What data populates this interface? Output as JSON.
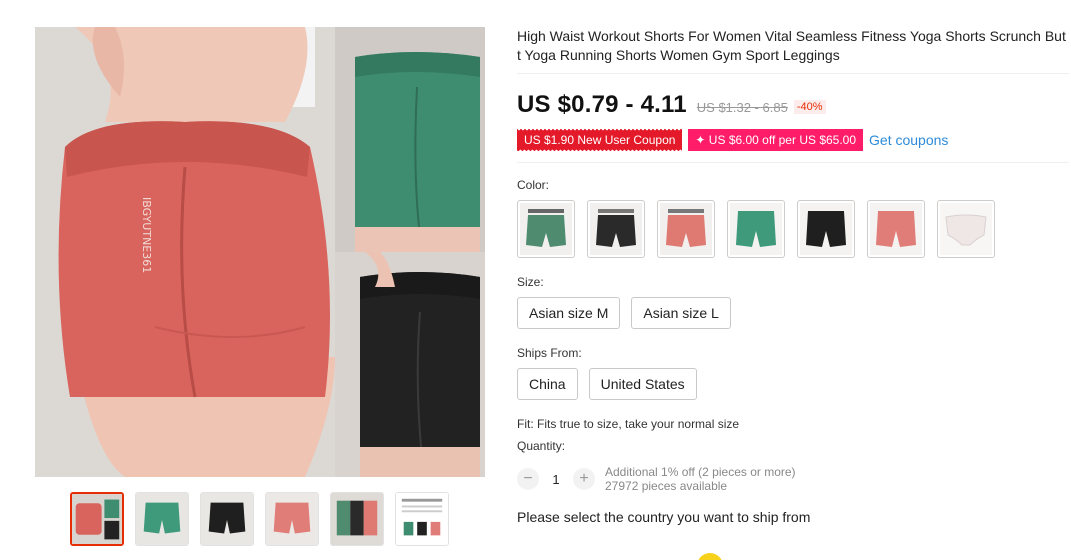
{
  "product": {
    "title": "High Waist Workout Shorts For Women Vital Seamless Fitness Yoga Shorts Scrunch Butt Yoga Running Shorts Women Gym Sport Leggings"
  },
  "price": {
    "current": "US $0.79 - 4.11",
    "original": "US $1.32 - 6.85",
    "discount": "-40%"
  },
  "coupons": {
    "new_user": "US $1.90 New User Coupon",
    "store": "✦ US $6.00 off per US $65.00",
    "get_link": "Get coupons"
  },
  "color": {
    "label": "Color:",
    "swatches": [
      {
        "name": "green-lace",
        "color": "#4f8b6e"
      },
      {
        "name": "black-lace",
        "color": "#2a2a2a"
      },
      {
        "name": "pink-lace",
        "color": "#de7a72"
      },
      {
        "name": "green",
        "color": "#3f9a7c"
      },
      {
        "name": "black",
        "color": "#1f1f1f"
      },
      {
        "name": "pink",
        "color": "#e07d78"
      },
      {
        "name": "white",
        "color": "#f1ecea"
      }
    ]
  },
  "size": {
    "label": "Size:",
    "options": [
      "Asian size M",
      "Asian size L"
    ]
  },
  "ships_from": {
    "label": "Ships From:",
    "options": [
      "China",
      "United States"
    ]
  },
  "fit_note": "Fit: Fits true to size, take your normal size",
  "quantity": {
    "label": "Quantity:",
    "value": "1",
    "minus": "−",
    "plus": "+",
    "note_line1": "Additional 1% off (2 pieces or more)",
    "note_line2": "27972 pieces available"
  },
  "shipping_prompt": "Please select the country you want to ship from",
  "colors": {
    "accent": "#e62e04",
    "coupon_red": "#e4192a",
    "coupon_pink": "#ff1c68",
    "link_blue": "#2e8bd8",
    "shorts_pink": "#d9645d",
    "shorts_green": "#3f8d70",
    "shorts_black": "#222222"
  }
}
